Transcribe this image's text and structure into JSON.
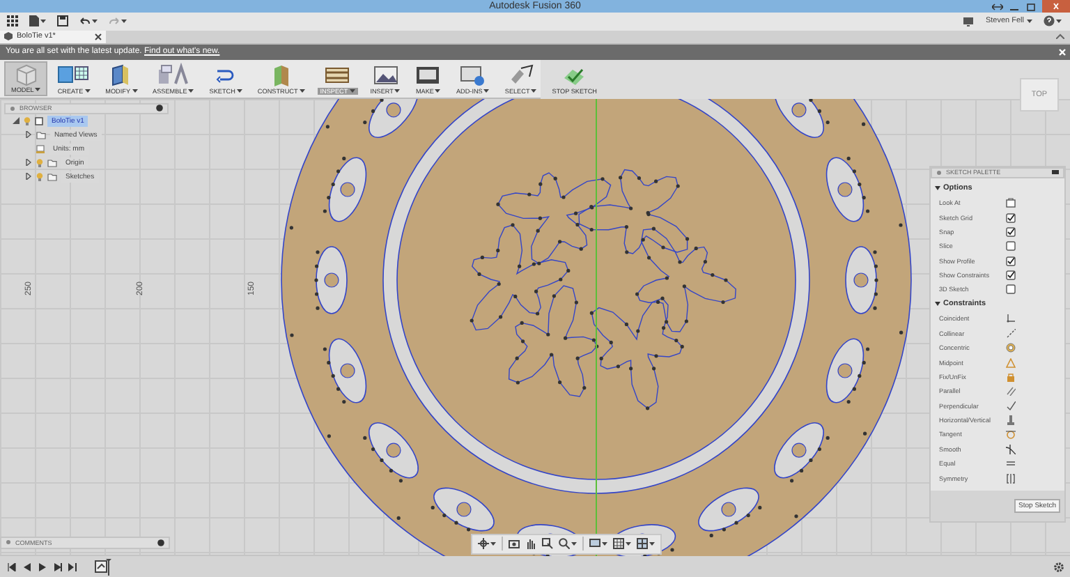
{
  "window": {
    "title": "Autodesk Fusion 360"
  },
  "quick_access": {
    "user": "Steven Fell"
  },
  "document_tabs": [
    {
      "label": "BoloTie v1*",
      "selected": true
    }
  ],
  "notification": {
    "text": "You are all set with the latest update.",
    "link": "Find out what's new."
  },
  "toolbar": [
    {
      "label": "MODEL",
      "kind": "workspace",
      "selected": false
    },
    {
      "label": "CREATE",
      "kind": "menu",
      "selected": false
    },
    {
      "label": "MODIFY",
      "kind": "menu",
      "selected": false
    },
    {
      "label": "ASSEMBLE",
      "kind": "menu",
      "selected": false
    },
    {
      "label": "SKETCH",
      "kind": "menu",
      "selected": false
    },
    {
      "label": "CONSTRUCT",
      "kind": "menu",
      "selected": false
    },
    {
      "label": "INSPECT",
      "kind": "menu",
      "selected": true
    },
    {
      "label": "INSERT",
      "kind": "menu",
      "selected": false
    },
    {
      "label": "MAKE",
      "kind": "menu",
      "selected": false
    },
    {
      "label": "ADD-INS",
      "kind": "menu",
      "selected": false
    },
    {
      "label": "SELECT",
      "kind": "menu",
      "selected": false
    },
    {
      "label": "STOP SKETCH",
      "kind": "command",
      "selected": false
    }
  ],
  "browser": {
    "title": "BROWSER",
    "root": {
      "label": "BoloTie v1",
      "selected": true,
      "expanded": true,
      "children": [
        {
          "label": "Named Views",
          "kind": "folder",
          "expanded": false
        },
        {
          "label": "Units: mm",
          "kind": "units"
        },
        {
          "label": "Origin",
          "kind": "visible_folder",
          "expanded": false
        },
        {
          "label": "Sketches",
          "kind": "visible_folder",
          "expanded": false
        }
      ]
    }
  },
  "view_cube": {
    "label": "TOP"
  },
  "ruler_labels": [
    "250",
    "200",
    "150"
  ],
  "sketch_palette": {
    "title": "SKETCH PALETTE",
    "sections": [
      {
        "title": "Options",
        "expanded": true,
        "items": [
          {
            "label": "Look At",
            "kind": "button"
          },
          {
            "label": "Sketch Grid",
            "kind": "checkbox",
            "checked": true
          },
          {
            "label": "Snap",
            "kind": "checkbox",
            "checked": true
          },
          {
            "label": "Slice",
            "kind": "checkbox",
            "checked": false
          },
          {
            "label": "Show Profile",
            "kind": "checkbox",
            "checked": true
          },
          {
            "label": "Show Constraints",
            "kind": "checkbox",
            "checked": true
          },
          {
            "label": "3D Sketch",
            "kind": "checkbox",
            "checked": false
          }
        ]
      },
      {
        "title": "Constraints",
        "expanded": true,
        "items": [
          {
            "label": "Coincident",
            "kind": "constraint"
          },
          {
            "label": "Collinear",
            "kind": "constraint"
          },
          {
            "label": "Concentric",
            "kind": "constraint"
          },
          {
            "label": "Midpoint",
            "kind": "constraint"
          },
          {
            "label": "Fix/UnFix",
            "kind": "constraint"
          },
          {
            "label": "Parallel",
            "kind": "constraint"
          },
          {
            "label": "Perpendicular",
            "kind": "constraint"
          },
          {
            "label": "Horizontal/Vertical",
            "kind": "constraint"
          },
          {
            "label": "Tangent",
            "kind": "constraint"
          },
          {
            "label": "Smooth",
            "kind": "constraint"
          },
          {
            "label": "Equal",
            "kind": "constraint"
          },
          {
            "label": "Symmetry",
            "kind": "constraint"
          }
        ]
      }
    ],
    "button": "Stop Sketch"
  },
  "comments": {
    "title": "COMMENTS"
  }
}
